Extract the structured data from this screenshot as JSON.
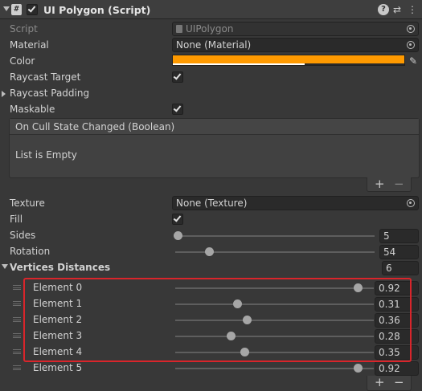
{
  "header": {
    "title": "UI Polygon (Script)",
    "script_icon": "#",
    "enabled": true
  },
  "props": {
    "script": {
      "label": "Script",
      "value": "UIPolygon"
    },
    "material": {
      "label": "Material",
      "value": "None (Material)"
    },
    "color": {
      "label": "Color",
      "hex": "#FF9A00",
      "alpha": 0.57
    },
    "raycast_target": {
      "label": "Raycast Target",
      "checked": true
    },
    "raycast_padding": {
      "label": "Raycast Padding"
    },
    "maskable": {
      "label": "Maskable",
      "checked": true
    },
    "event": {
      "title": "On Cull State Changed (Boolean)",
      "empty": "List is Empty"
    },
    "texture": {
      "label": "Texture",
      "value": "None (Texture)"
    },
    "fill": {
      "label": "Fill",
      "checked": true
    },
    "sides": {
      "label": "Sides",
      "value": "5",
      "fraction": 0.0
    },
    "rotation": {
      "label": "Rotation",
      "value": "54",
      "fraction": 0.15
    }
  },
  "vertices": {
    "label": "Vertices Distances",
    "size": "6",
    "elements": [
      {
        "label": "Element 0",
        "value": "0.92"
      },
      {
        "label": "Element 1",
        "value": "0.31"
      },
      {
        "label": "Element 2",
        "value": "0.36"
      },
      {
        "label": "Element 3",
        "value": "0.28"
      },
      {
        "label": "Element 4",
        "value": "0.35"
      },
      {
        "label": "Element 5",
        "value": "0.92"
      }
    ]
  },
  "list_controls": {
    "add": "+",
    "remove": "−"
  },
  "colors": {
    "highlight": "#D9252B",
    "accent": "#FF9A00"
  }
}
